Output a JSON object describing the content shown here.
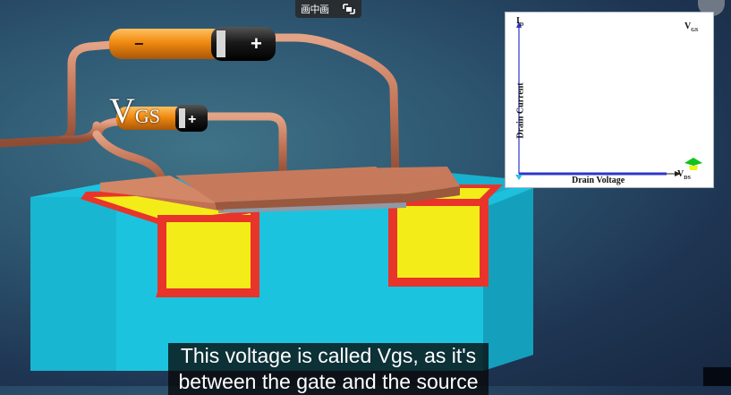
{
  "player": {
    "pip_label": "画中画",
    "pip_icon": "picture-in-picture-icon",
    "corner_icon": "close-icon"
  },
  "scene": {
    "vgs_label_main": "V",
    "vgs_label_sub": "GS",
    "battery_top_minus": "−",
    "battery_top_plus": "+",
    "battery_small_plus": "+",
    "colors": {
      "substrate": "#19b8d4",
      "well": "#f4ec18",
      "border": "#e8342a",
      "copper": "#c07053",
      "oxide": "#8f9aa6"
    }
  },
  "graph": {
    "id_label": "I",
    "id_sub": "D",
    "vgs_label": "V",
    "vgs_sub": "GS",
    "ylabel": "Drain Current",
    "xlabel": "Drain Voltage",
    "vds_label": "V",
    "vds_sub": "DS"
  },
  "caption": {
    "line1": "This voltage is called Vgs, as it's",
    "line2": "between the gate and the source"
  }
}
